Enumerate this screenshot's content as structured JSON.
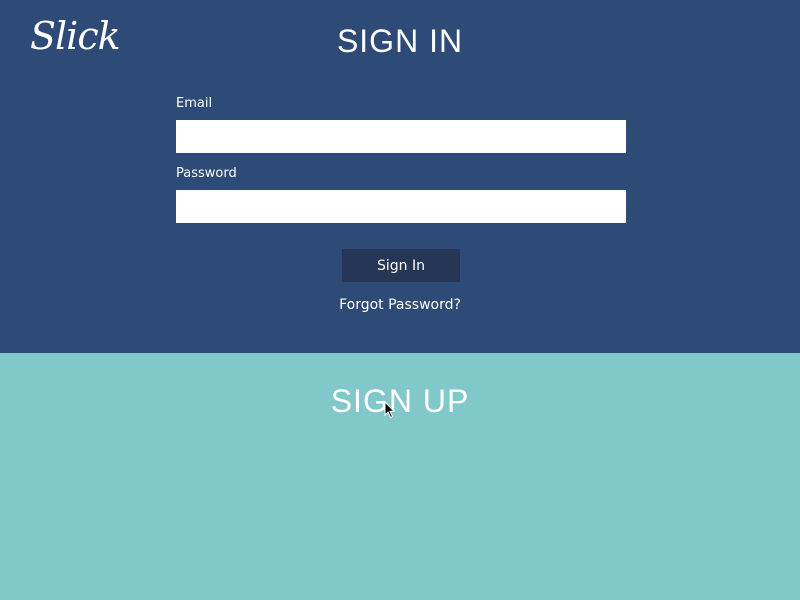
{
  "brand": {
    "logo_text": "Slick"
  },
  "signin": {
    "title": "SIGN IN",
    "email_label": "Email",
    "email_value": "",
    "password_label": "Password",
    "password_value": "",
    "button_label": "Sign In",
    "forgot_label": "Forgot Password?"
  },
  "signup": {
    "title": "SIGN UP"
  },
  "icons": {
    "cursor": "arrow-cursor-icon"
  },
  "colors": {
    "signin_bg": "#2e4a77",
    "signup_bg": "#80c8c9",
    "button_bg": "#253656"
  }
}
